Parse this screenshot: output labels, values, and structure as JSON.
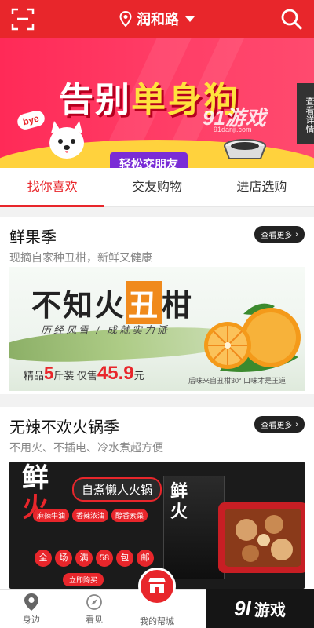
{
  "header": {
    "location": "润和路"
  },
  "banner": {
    "title_part1": "告别",
    "title_part2": "单身狗",
    "subtitle": "轻松交朋友",
    "bye_text": "bye",
    "side_text": "查看详情",
    "watermark": "91游戏",
    "watermark_url": "91danji.com"
  },
  "tabs": [
    {
      "label": "找你喜欢",
      "active": true
    },
    {
      "label": "交友购物",
      "active": false
    },
    {
      "label": "进店选购",
      "active": false
    }
  ],
  "sections": [
    {
      "title": "鲜果季",
      "subtitle": "现摘自家种丑柑，新鲜又健康",
      "more_label": "查看更多",
      "image": {
        "headline_a": "不知火",
        "headline_box": "丑",
        "headline_b": "柑",
        "tagline": "历经风雪 / 成就实力派",
        "price_prefix": "精品",
        "price_qty": "5",
        "price_unit": "斤装 仅售",
        "price_value": "45.9",
        "price_currency": "元",
        "small_note": "后味来自丑柑30° 口味才是王道"
      }
    },
    {
      "title": "无辣不欢火锅季",
      "subtitle": "不用火、不插电、冷水煮超方便",
      "more_label": "查看更多",
      "image": {
        "big_1": "鲜",
        "big_2": "火",
        "tag": "自煮懒人火锅",
        "chips": [
          "麻辣牛油",
          "香辣浓油",
          "醇香素菜"
        ],
        "dots": [
          "全",
          "场",
          "满",
          "58",
          "包",
          "邮"
        ],
        "buy": "立即购买",
        "box_text_1": "鲜",
        "box_text_2": "火"
      }
    }
  ],
  "bottom_nav": [
    {
      "label": "身边"
    },
    {
      "label": "看见"
    },
    {
      "label": "我的帮城"
    }
  ],
  "bottom_watermark": {
    "num": "9l",
    "text": "游戏"
  },
  "colors": {
    "accent": "#e8262b",
    "banner": "#ff3e67",
    "yellow": "#ffd23d"
  }
}
